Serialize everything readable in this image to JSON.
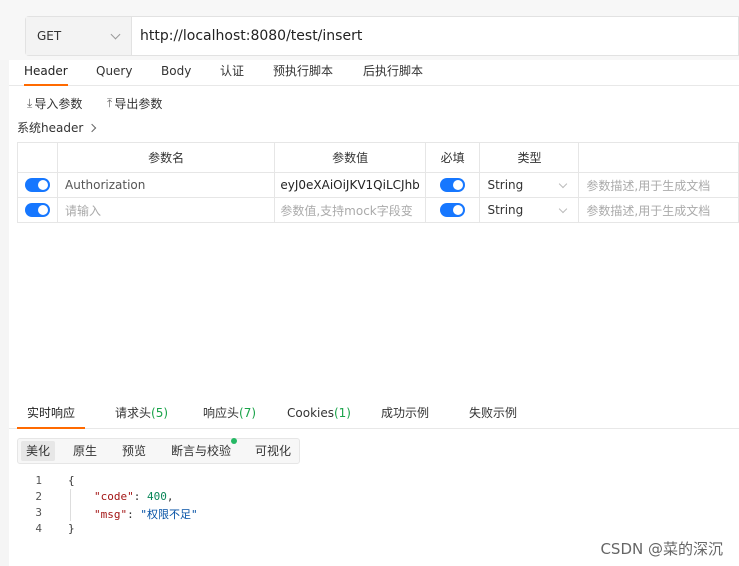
{
  "request": {
    "method": "GET",
    "url": "http://localhost:8080/test/insert"
  },
  "tabs": [
    "Header",
    "Query",
    "Body",
    "认证",
    "预执行脚本",
    "后执行脚本"
  ],
  "toolbar": {
    "import_label": "导入参数",
    "export_label": "导出参数"
  },
  "system_header": "系统header",
  "table": {
    "headers": [
      "参数名",
      "参数值",
      "必填",
      "类型"
    ],
    "rows": [
      {
        "enabled": true,
        "name": "Authorization",
        "value": "eyJ0eXAiOiJKV1QiLCJhb",
        "required": true,
        "type": "String",
        "desc_placeholder": "参数描述,用于生成文档"
      },
      {
        "enabled": true,
        "name_placeholder": "请输入",
        "value_placeholder": "参数值,支持mock字段变",
        "required": true,
        "type": "String",
        "desc_placeholder": "参数描述,用于生成文档"
      }
    ]
  },
  "response_tabs": [
    {
      "label": "实时响应",
      "count": ""
    },
    {
      "label": "请求头",
      "count": "(5)"
    },
    {
      "label": "响应头",
      "count": "(7)"
    },
    {
      "label": "Cookies",
      "count": "(1)"
    },
    {
      "label": "成功示例",
      "count": ""
    },
    {
      "label": "失败示例",
      "count": ""
    }
  ],
  "view_tabs": [
    "美化",
    "原生",
    "预览",
    "断言与校验",
    "可视化"
  ],
  "response_body": {
    "line_numbers": [
      "1",
      "2",
      "3",
      "4"
    ],
    "open_brace": "{",
    "close_brace": "}",
    "code_key": "\"code\"",
    "code_value": "400",
    "msg_key": "\"msg\"",
    "msg_value": "\"权限不足\""
  },
  "watermark": "CSDN @菜的深沉",
  "colors": {
    "accent": "#ff6a00",
    "toggle": "#1677ff",
    "count_green": "#1aa34a"
  }
}
